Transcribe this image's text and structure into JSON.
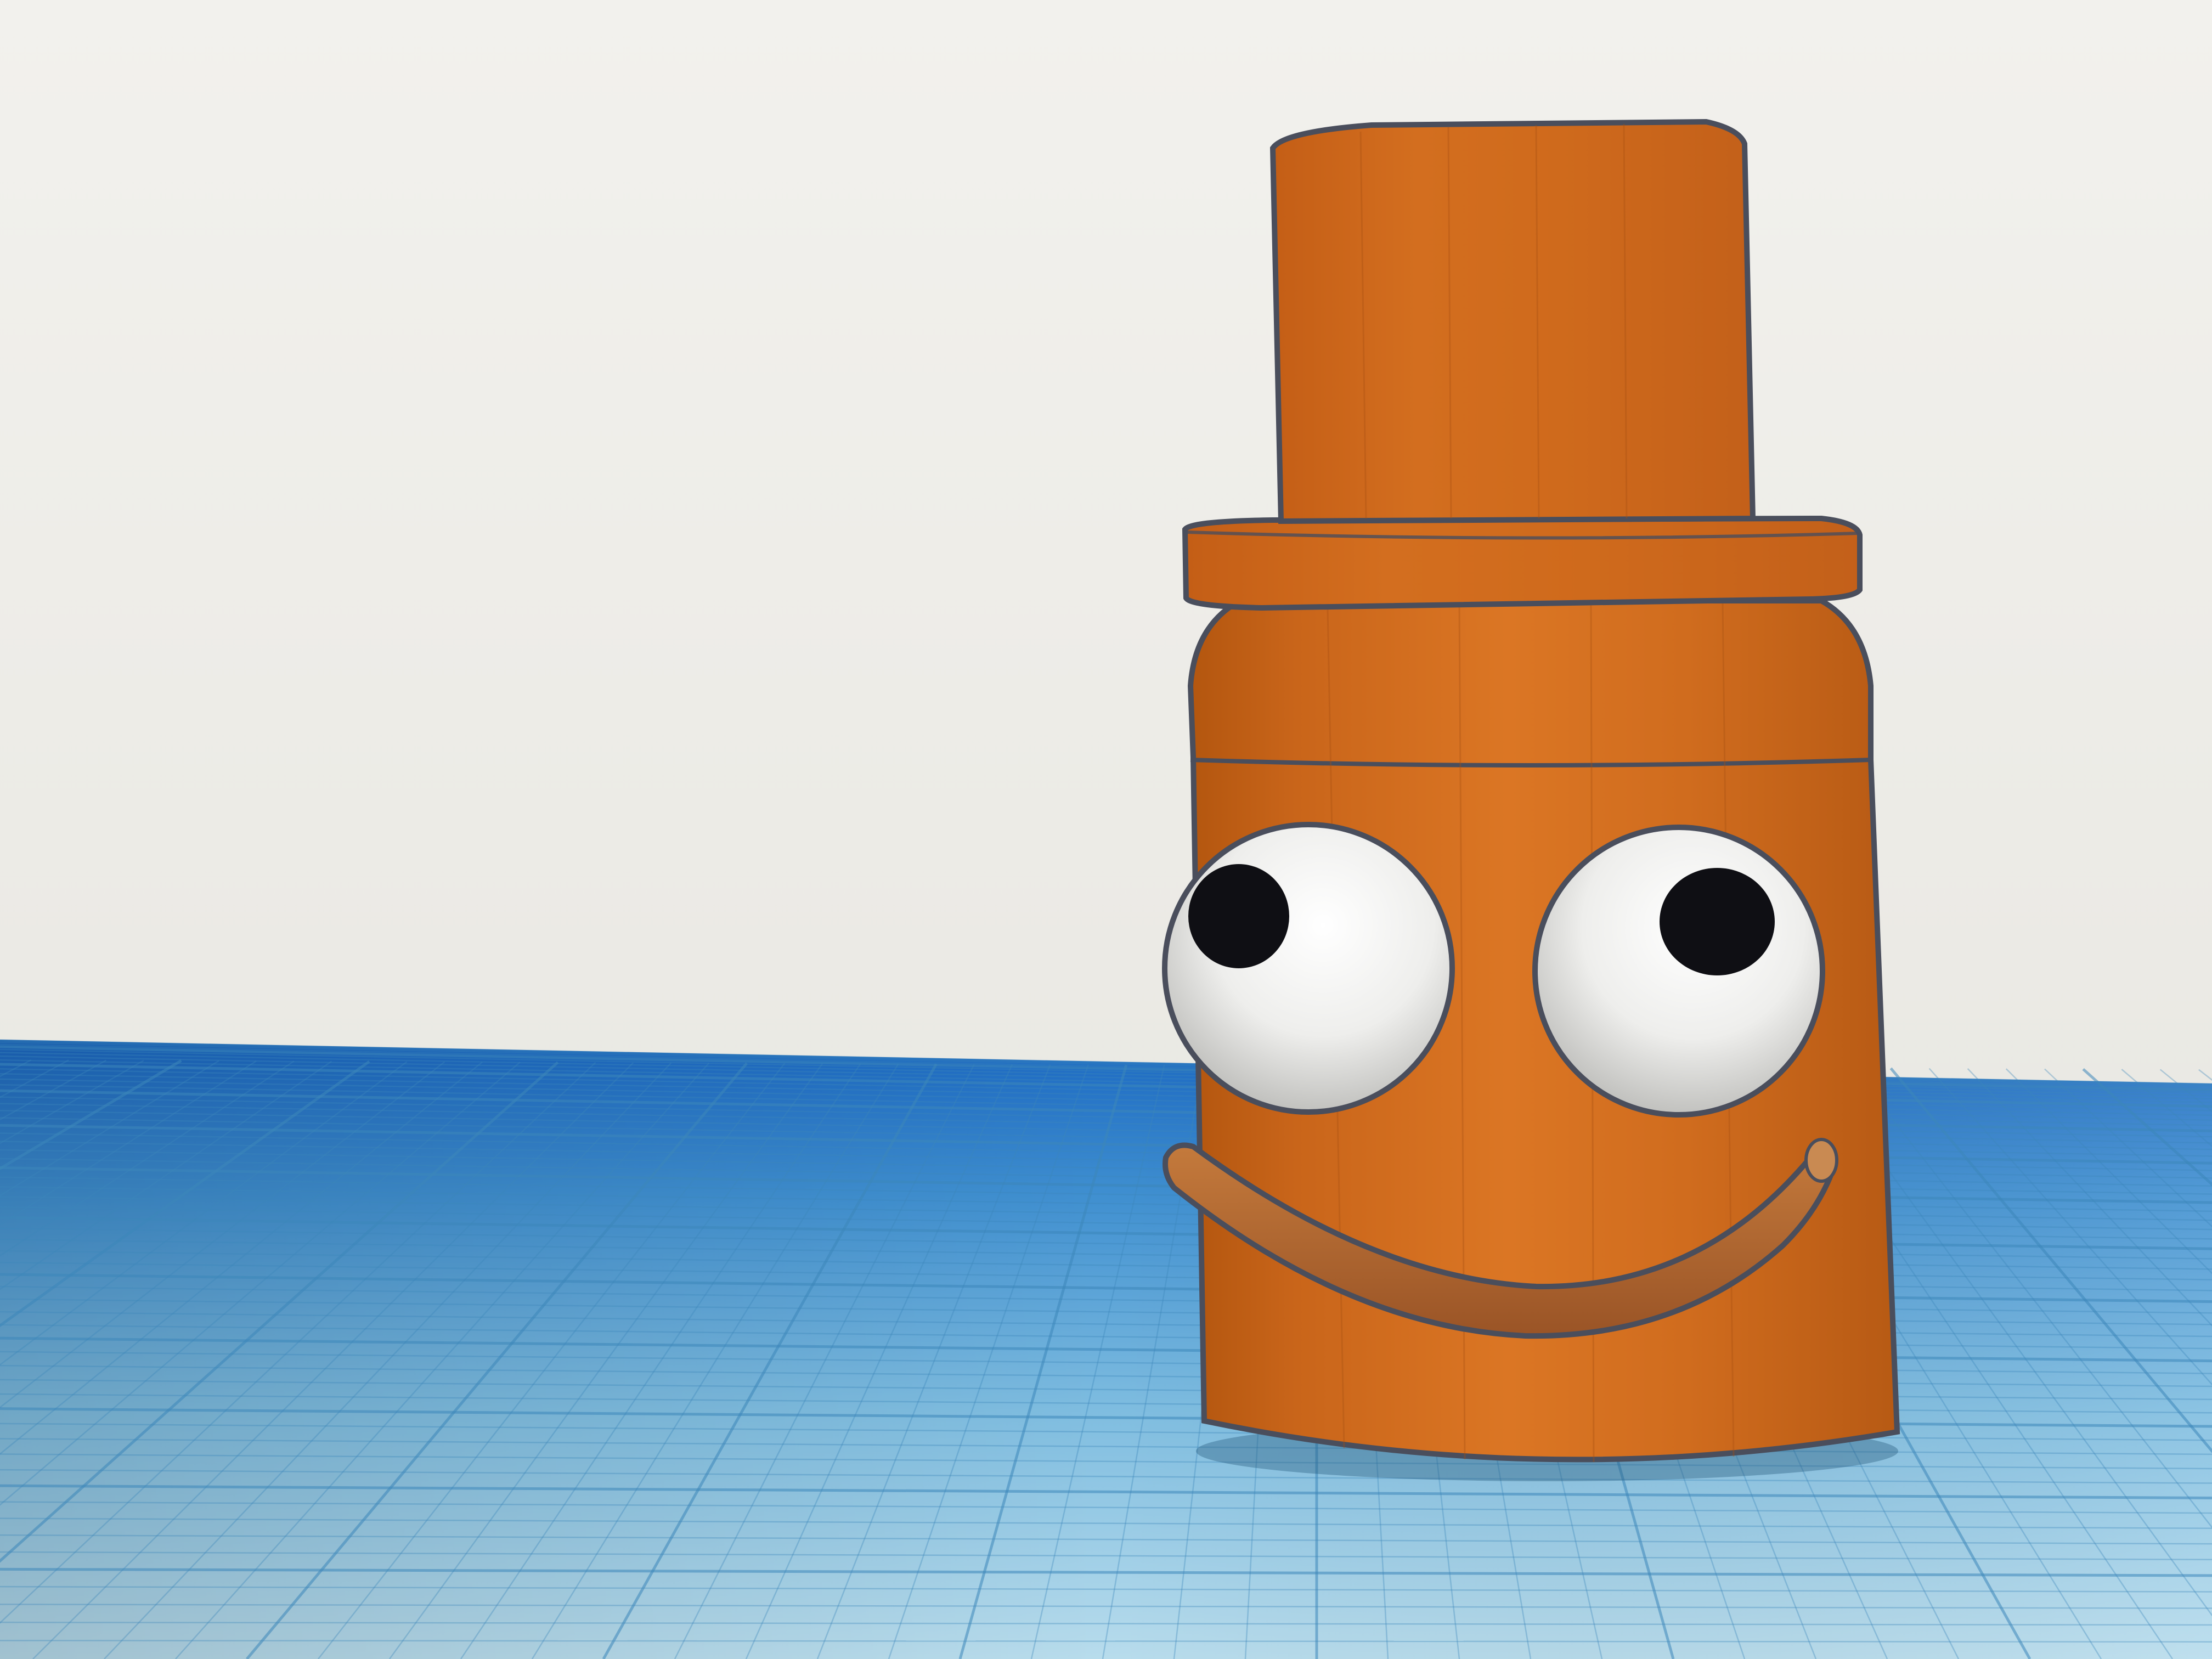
{
  "app": {
    "view": "3d-workplane"
  },
  "colors": {
    "background_top": "#f1f0ec",
    "background_bottom": "#e4e3dd",
    "grid_far": "#1f6fc4",
    "grid_near": "#9fd0e6",
    "grid_line": "#3f86b8",
    "grid_line_minor": "#6aa9cc",
    "body_orange": "#d06a1c",
    "body_orange_light": "#e07d2a",
    "body_orange_dark": "#a9500f",
    "outline": "#4a4e5c",
    "eye_white": "#f2f2f0",
    "eye_shadow": "#c9c9c6",
    "pupil": "#101014",
    "mouth": "#b66a32",
    "mouth_dark": "#8a4a20"
  },
  "scene": {
    "objects": [
      {
        "name": "top-hat-crown",
        "shape": "cylinder",
        "color": "orange"
      },
      {
        "name": "top-hat-brim",
        "shape": "cylinder",
        "color": "orange"
      },
      {
        "name": "body",
        "shape": "cylinder",
        "color": "orange"
      },
      {
        "name": "left-eye",
        "shape": "sphere",
        "color": "white"
      },
      {
        "name": "right-eye",
        "shape": "sphere",
        "color": "white"
      },
      {
        "name": "mouth",
        "shape": "curved-tube",
        "color": "brown"
      }
    ],
    "workplane": {
      "grid": true
    }
  }
}
